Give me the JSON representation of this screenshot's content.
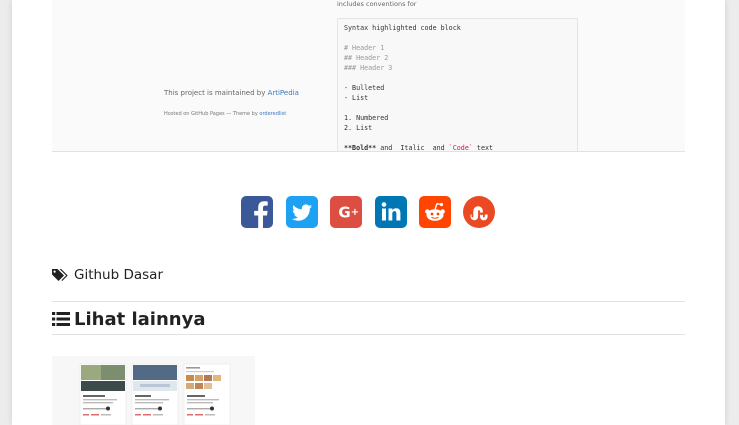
{
  "preview": {
    "top_note": "includes conventions for",
    "maintained_prefix": "This project is maintained by ",
    "maintained_link": "ArtiPedia",
    "hosted_prefix": "Hosted on GitHub Pages — Theme by ",
    "hosted_link": "orderedlist",
    "code_title": "Syntax highlighted code block",
    "code_lines": [
      "# Header 1",
      "## Header 2",
      "### Header 3",
      "- Bulleted",
      "- List",
      "1. Numbered",
      "2. List"
    ],
    "code_last": {
      "bold_part": "**Bold**",
      "and1": " and ",
      "italic_part": "_Italic_",
      "and2": " and ",
      "code_part": "`Code`",
      "tail": " text"
    }
  },
  "share": {
    "icons": [
      "facebook-icon",
      "twitter-icon",
      "google-plus-icon",
      "linkedin-icon",
      "reddit-icon",
      "stumbleupon-icon"
    ],
    "colors": {
      "facebook": "#3b5998",
      "twitter": "#1da1f2",
      "google_plus": "#dc4e41",
      "linkedin": "#0077b5",
      "reddit": "#ff4500",
      "stumbleupon": "#eb4924"
    }
  },
  "tags": {
    "icon": "tags-icon",
    "label": "Github Dasar"
  },
  "more": {
    "icon": "list-icon",
    "title": "Lihat lainnya"
  }
}
